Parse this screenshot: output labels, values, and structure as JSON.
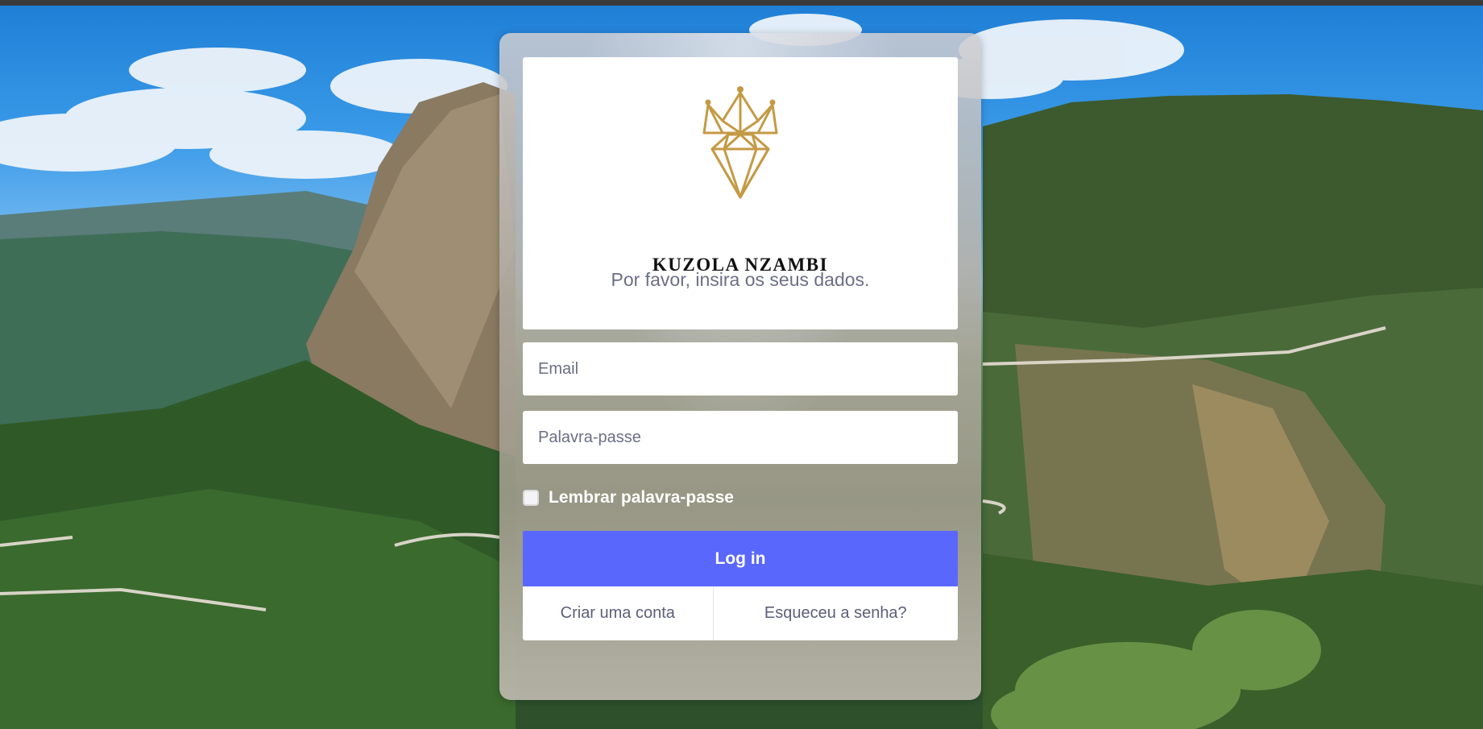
{
  "brand": {
    "name": "KUZOLA NZAMBI",
    "logo_icon": "crown-diamond-icon",
    "accent_color": "#c49a45"
  },
  "login": {
    "subtitle": "Por favor, insira os seus dados.",
    "email_placeholder": "Email",
    "password_placeholder": "Palavra-passe",
    "remember_label": "Lembrar palavra-passe",
    "remember_checked": false,
    "submit_label": "Log in",
    "submit_color": "#5a67fc",
    "create_account_label": "Criar uma conta",
    "forgot_password_label": "Esqueceu a senha?"
  }
}
